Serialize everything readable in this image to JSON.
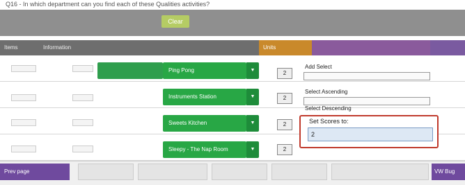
{
  "question": "Q16 - In which department can you find each of these Qualities activities?",
  "toolbar": {
    "clear_label": "Clear"
  },
  "header": {
    "col1": "Items",
    "col2": "Information",
    "score_label": "Units"
  },
  "rows": [
    {
      "department": "Ping Pong",
      "score": "2"
    },
    {
      "department": "Instruments Station",
      "score": "2"
    },
    {
      "department": "Sweets Kitchen",
      "score": "2"
    },
    {
      "department": "Sleepy - The Nap Room",
      "score": "2"
    }
  ],
  "options": {
    "opt1": "Add Select",
    "opt2": "Select Ascending",
    "opt3": "Select Descending"
  },
  "popup": {
    "label": "Set Scores to:",
    "value": "2"
  },
  "footer": {
    "left_label": "Prev page",
    "right_label": "VW Bug"
  }
}
